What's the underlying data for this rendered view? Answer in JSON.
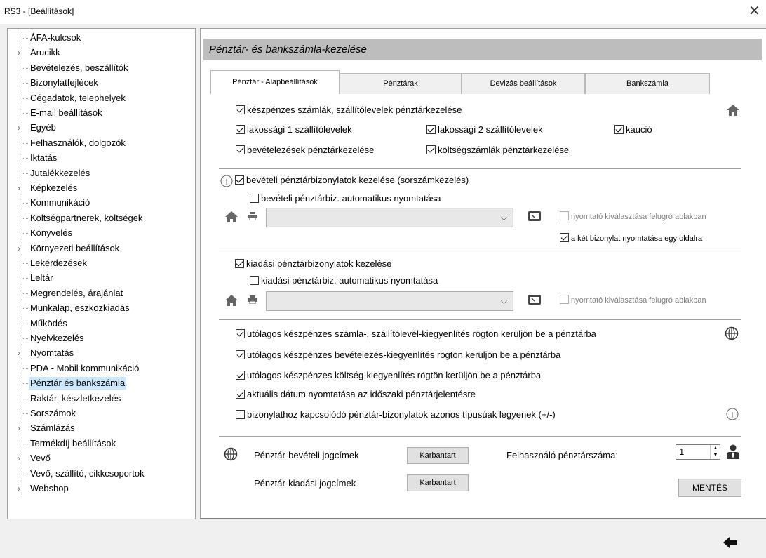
{
  "window": {
    "title": "RS3 - [Beállítások]",
    "close_glyph": "✕"
  },
  "tree": {
    "items": [
      {
        "label": "ÁFA-kulcsok",
        "expandable": false
      },
      {
        "label": "Árucikk",
        "expandable": true
      },
      {
        "label": "Bevételezés, beszállítók",
        "expandable": false
      },
      {
        "label": "Bizonylatfejlécek",
        "expandable": false
      },
      {
        "label": "Cégadatok, telephelyek",
        "expandable": false
      },
      {
        "label": "E-mail beállítások",
        "expandable": false
      },
      {
        "label": "Egyéb",
        "expandable": true
      },
      {
        "label": "Felhasználók, dolgozók",
        "expandable": false
      },
      {
        "label": "Iktatás",
        "expandable": false
      },
      {
        "label": "Jutalékkezelés",
        "expandable": false
      },
      {
        "label": "Képkezelés",
        "expandable": true
      },
      {
        "label": "Kommunikáció",
        "expandable": false
      },
      {
        "label": "Költségpartnerek, költségek",
        "expandable": false
      },
      {
        "label": "Könyvelés",
        "expandable": false
      },
      {
        "label": "Környezeti beállítások",
        "expandable": true
      },
      {
        "label": "Lekérdezések",
        "expandable": false
      },
      {
        "label": "Leltár",
        "expandable": false
      },
      {
        "label": "Megrendelés, árajánlat",
        "expandable": false
      },
      {
        "label": "Munkalap, eszközkiadás",
        "expandable": false
      },
      {
        "label": "Működés",
        "expandable": false
      },
      {
        "label": "Nyelvkezelés",
        "expandable": false
      },
      {
        "label": "Nyomtatás",
        "expandable": true
      },
      {
        "label": "PDA - Mobil kommunikáció",
        "expandable": false
      },
      {
        "label": "Pénztár és bankszámla",
        "expandable": false,
        "selected": true
      },
      {
        "label": "Raktár, készletkezelés",
        "expandable": false
      },
      {
        "label": "Sorszámok",
        "expandable": false
      },
      {
        "label": "Számlázás",
        "expandable": true
      },
      {
        "label": "Termékdíj beállítások",
        "expandable": false
      },
      {
        "label": "Vevő",
        "expandable": true
      },
      {
        "label": "Vevő, szállító, cikkcsoportok",
        "expandable": false
      },
      {
        "label": "Webshop",
        "expandable": true
      }
    ]
  },
  "panel": {
    "title": "Pénztár- és bankszámla-kezelése",
    "tabs": [
      {
        "label": "Pénztár - Alapbeállítások",
        "active": true
      },
      {
        "label": "Pénztárak"
      },
      {
        "label": "Devizás beállítások"
      },
      {
        "label": "Bankszámla"
      }
    ],
    "section1": {
      "cash_invoices": {
        "label": "készpénzes számlák, szállítólevelek pénztárkezelése",
        "checked": true
      },
      "retail1": {
        "label": "lakossági 1 szállítólevelek",
        "checked": true
      },
      "retail2": {
        "label": "lakossági 2 szállítólevelek",
        "checked": true
      },
      "deposit": {
        "label": "kaució",
        "checked": true
      },
      "receipts": {
        "label": "bevételezések pénztárkezelése",
        "checked": true
      },
      "expense_invoices": {
        "label": "költségszámlák pénztárkezelése",
        "checked": true
      }
    },
    "section2": {
      "income_vouchers": {
        "label": "bevételi pénztárbizonylatok kezelése (sorszámkezelés)",
        "checked": true
      },
      "income_autoprint": {
        "label": "bevételi pénztárbiz. automatikus nyomtatása",
        "checked": false
      },
      "printer_popup": {
        "label": "nyomtató kiválasztása felugró ablakban",
        "checked": false
      },
      "two_on_page": {
        "label": "a két bizonylat nyomtatása egy oldalra",
        "checked": true
      }
    },
    "section3": {
      "expense_vouchers": {
        "label": "kiadási pénztárbizonylatok kezelése",
        "checked": true
      },
      "expense_autoprint": {
        "label": "kiadási pénztárbiz. automatikus nyomtatása",
        "checked": false
      },
      "printer_popup": {
        "label": "nyomtató kiválasztása felugró ablakban",
        "checked": false
      }
    },
    "section4": {
      "opt1": {
        "label": "utólagos készpénzes számla-, szállítólevél-kiegyenlítés rögtön kerüljön be a pénztárba",
        "checked": true
      },
      "opt2": {
        "label": "utólagos készpénzes bevételezés-kiegyenlítés rögtön kerüljön be a pénztárba",
        "checked": true
      },
      "opt3": {
        "label": "utólagos készpénzes költség-kiegyenlítés rögtön kerüljön be a pénztárba",
        "checked": true
      },
      "opt4": {
        "label": "aktuális dátum nyomtatása az időszaki pénztárjelentésre",
        "checked": true
      },
      "opt5": {
        "label": "bizonylathoz kapcsolódó pénztár-bizonylatok azonos típusúak legyenek (+/-)",
        "checked": false
      }
    },
    "footer": {
      "income_titles_label": "Pénztár-bevételi jogcímek",
      "expense_titles_label": "Pénztár-kiadási jogcímek",
      "maintain_label": "Karbantart",
      "user_cashbox_label": "Felhasználó pénztárszáma:",
      "user_cashbox_value": "1",
      "save_label": "MENTÉS"
    }
  }
}
